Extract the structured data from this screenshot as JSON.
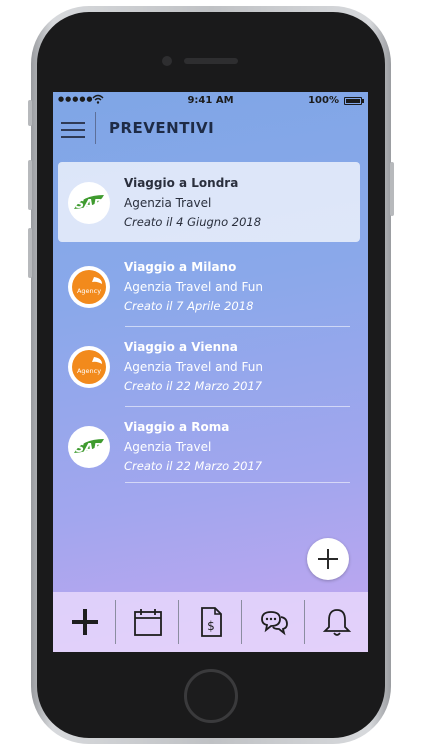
{
  "status_bar": {
    "signal": "●●●●●",
    "time": "9:41 AM",
    "battery": "100%"
  },
  "nav": {
    "title": "PREVENTIVI"
  },
  "logos": {
    "sap": "SAP",
    "agency": "Agency"
  },
  "quotes": [
    {
      "title": "Viaggio a Londra",
      "agency": "Agenzia Travel",
      "created": "Creato il 4 Giugno 2018",
      "logo": "sap-logo",
      "selected": true
    },
    {
      "title": "Viaggio a Milano",
      "agency": "Agenzia Travel and Fun",
      "created": "Creato il 7 Aprile 2018",
      "logo": "agency-logo",
      "selected": false
    },
    {
      "title": "Viaggio a Vienna",
      "agency": "Agenzia Travel and Fun",
      "created": "Creato il 22 Marzo 2017",
      "logo": "agency-logo",
      "selected": false
    },
    {
      "title": "Viaggio a Roma",
      "agency": "Agenzia Travel",
      "created": "Creato il 22 Marzo 2017",
      "logo": "sap-logo",
      "selected": false
    }
  ],
  "tabbar": {
    "icons": [
      "plus-icon",
      "calendar-icon",
      "invoice-dollar-icon",
      "chat-icon",
      "bell-icon"
    ]
  },
  "colors": {
    "sap_green": "#3f9b2f",
    "agency_orange": "#f28a1c",
    "title_text": "#1e2b46"
  }
}
